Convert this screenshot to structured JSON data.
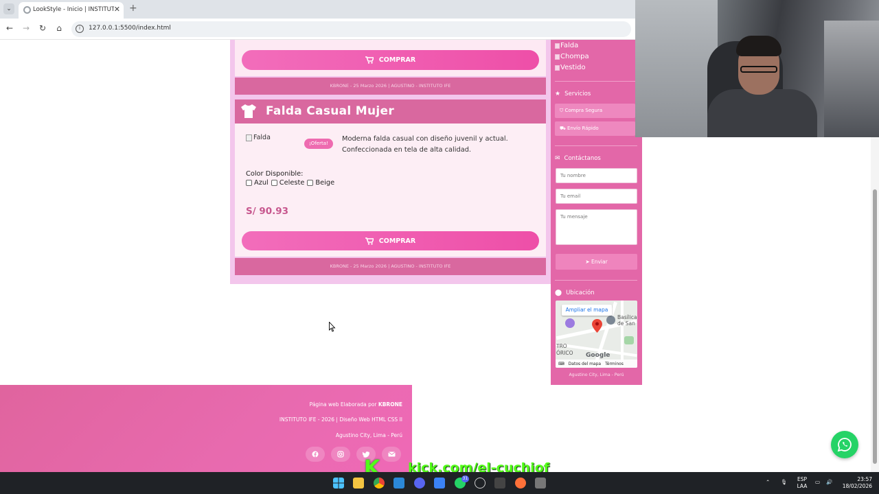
{
  "browser": {
    "tab_title": "LookStyle - Inicio | INSTITUTO IF",
    "url": "127.0.0.1:5500/index.html"
  },
  "card_top": {
    "buy_label": "COMPRAR",
    "footer": "KBRONE - 25 Marzo 2026 | AGUSTINO - INSTITUTO IFE"
  },
  "product": {
    "title": "Falda Casual Mujer",
    "image_alt": "Falda",
    "badge": "¡Oferta!",
    "description": "Moderna falda casual con diseño juvenil y actual. Confeccionada en tela de alta calidad.",
    "color_label": "Color Disponible:",
    "colors": [
      "Azul",
      "Celeste",
      "Beige"
    ],
    "price": "S/ 90.93",
    "buy_label": "COMPRAR",
    "footer": "KBRONE - 25 Marzo 2026 | AGUSTINO - INSTITUTO IFE"
  },
  "sidebar": {
    "links": [
      "Falda",
      "Chompa",
      "Vestido"
    ],
    "services_title": "Servicios",
    "services": [
      "Compra Segura",
      "Envío Rápido"
    ],
    "contact_title": "Contáctanos",
    "name_placeholder": "Tu nombre",
    "email_placeholder": "Tu email",
    "message_placeholder": "Tu mensaje",
    "send_label": "Enviar",
    "location_title": "Ubicación",
    "map_button": "Ampliar el mapa",
    "map_labels": [
      "Basílica de San",
      "TRO",
      "ÓRICO"
    ],
    "map_google": "Google",
    "map_data": "Datos del mapa",
    "map_terms": "Términos",
    "location_text": "Agustino City, Lima - Perú"
  },
  "footer": {
    "credit_prefix": "Página web Elaborada por ",
    "credit_name": "KBRONE",
    "line2": "INSTITUTO IFE - 2026 | Diseño Web HTML CSS II",
    "line3": "Agustino City, Lima - Perú"
  },
  "overlay": {
    "kick_text": "kick.com/el-cuchiof"
  },
  "taskbar": {
    "whatsapp_badge": "31",
    "lang": "ESP",
    "lang2": "LAA",
    "time": "23:57",
    "date": "18/02/2026"
  },
  "colors": {
    "pink_primary": "#e367a8",
    "pink_header": "#d9689f",
    "pink_button": "#ee4fa8",
    "price": "#c7578e",
    "whatsapp": "#25d366"
  }
}
